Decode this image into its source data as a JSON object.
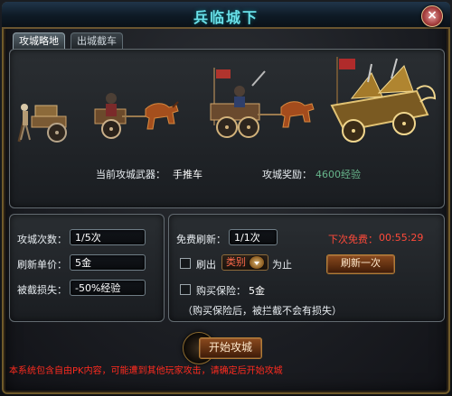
{
  "window": {
    "title": "兵临城下"
  },
  "tabs": [
    {
      "label": "攻城略地"
    },
    {
      "label": "出城截车"
    }
  ],
  "weapons": [
    {
      "icon": "push-cart-icon"
    },
    {
      "icon": "horse-chariot-icon"
    },
    {
      "icon": "war-chariot-icon"
    },
    {
      "icon": "golden-siege-engine-icon"
    }
  ],
  "siege_info": {
    "current_weapon_label": "当前攻城武器：",
    "current_weapon_value": "手推车",
    "reward_label": "攻城奖励：",
    "reward_value": "4600经验"
  },
  "left_panel": {
    "attempts_label": "攻城次数：",
    "attempts_value": "1/5次",
    "refresh_price_label": "刷新单价：",
    "refresh_price_value": "5金",
    "intercepted_loss_label": "被截损失：",
    "intercepted_loss_value": "-50%经验"
  },
  "right_panel": {
    "free_refresh_label": "免费刷新：",
    "free_refresh_value": "1/1次",
    "next_free_label": "下次免费：",
    "next_free_time": "00:55:29",
    "refresh_checkbox_label": "刷出",
    "category_select": "类别",
    "until_label": "为止",
    "refresh_once_button": "刷新一次",
    "insurance_label": "购买保险：",
    "insurance_price": "5金",
    "insurance_note": "（购买保险后，被拦截不会有损失）"
  },
  "actions": {
    "start_siege_button": "开始攻城"
  },
  "footer": {
    "warning": "本系统包含自由PK内容，可能遭到其他玩家攻击，请确定后开始攻城"
  },
  "colors": {
    "title_cyan": "#69e0e8",
    "red_warning": "#ff2b1f",
    "reward_green": "#67b58b",
    "button_brown": "#5e2e10"
  }
}
